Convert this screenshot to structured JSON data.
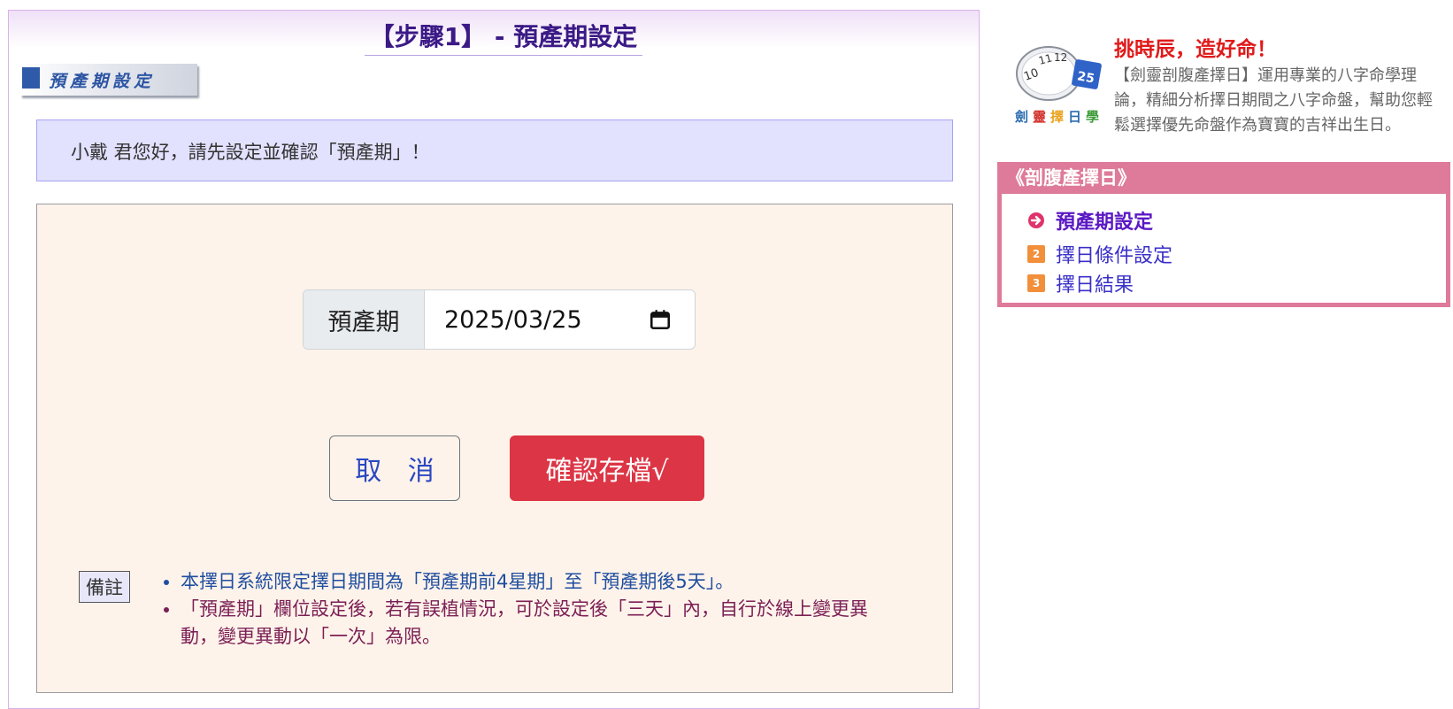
{
  "main": {
    "step_title": "【步驟1】 - 預產期設定",
    "section_banner": "預產期設定",
    "greeting": "小戴 君您好，請先設定並確認「預產期」！",
    "form": {
      "date_label": "預產期",
      "date_value": "2025/03/25",
      "cancel_label": "取 消",
      "save_label": "確認存檔√"
    },
    "notes": {
      "label": "備註",
      "items": [
        "本擇日系統限定擇日期間為「預產期前4星期」至「預產期後5天」。",
        "「預產期」欄位設定後，若有誤植情況，可於設定後「三天」內，自行於線上變更異動，變更異動以「一次」為限。"
      ]
    }
  },
  "sidebar": {
    "slogan": "挑時辰，造好命！",
    "logo_caption": "劍靈擇日學",
    "description": "【劍靈剖腹產擇日】運用專業的八字命學理論，精細分析擇日期間之八字命盤，幫助您輕鬆選擇優先命盤作為寶寶的吉祥出生日。",
    "nav": {
      "header": "《剖腹產擇日》",
      "items": [
        {
          "label": "預產期設定",
          "badge": ""
        },
        {
          "label": "擇日條件設定",
          "badge": "2"
        },
        {
          "label": "擇日結果",
          "badge": "3"
        }
      ]
    }
  },
  "colors": {
    "accent_purple": "#3b1a86",
    "save_red": "#dc3545",
    "nav_pink": "#de7a9a",
    "slogan_red": "#e01a1a"
  }
}
